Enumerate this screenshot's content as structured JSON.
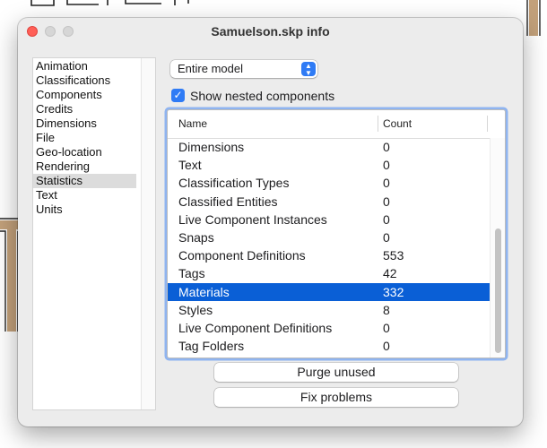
{
  "window": {
    "title": "Samuelson.skp info"
  },
  "sidebar": {
    "items": [
      {
        "label": "Animation"
      },
      {
        "label": "Classifications"
      },
      {
        "label": "Components"
      },
      {
        "label": "Credits"
      },
      {
        "label": "Dimensions"
      },
      {
        "label": "File"
      },
      {
        "label": "Geo-location"
      },
      {
        "label": "Rendering"
      },
      {
        "label": "Statistics",
        "selected": true
      },
      {
        "label": "Text"
      },
      {
        "label": "Units"
      }
    ]
  },
  "scope_select": {
    "value": "Entire model"
  },
  "nested_checkbox": {
    "label": "Show nested components",
    "checked": true
  },
  "table": {
    "columns": [
      "Name",
      "Count"
    ],
    "rows": [
      {
        "name": "Dimensions",
        "count": "0"
      },
      {
        "name": "Text",
        "count": "0"
      },
      {
        "name": "Classification Types",
        "count": "0"
      },
      {
        "name": "Classified Entities",
        "count": "0"
      },
      {
        "name": "Live Component Instances",
        "count": "0"
      },
      {
        "name": "Snaps",
        "count": "0"
      },
      {
        "name": "Component Definitions",
        "count": "553"
      },
      {
        "name": "Tags",
        "count": "42"
      },
      {
        "name": "Materials",
        "count": "332",
        "selected": true
      },
      {
        "name": "Styles",
        "count": "8"
      },
      {
        "name": "Live Component Definitions",
        "count": "0"
      },
      {
        "name": "Tag Folders",
        "count": "0"
      }
    ]
  },
  "buttons": {
    "purge_label": "Purge unused",
    "fix_label": "Fix problems"
  },
  "colors": {
    "accent": "#2f7bf5",
    "selection": "#0a5fd6",
    "close_button": "#ff5f57"
  }
}
